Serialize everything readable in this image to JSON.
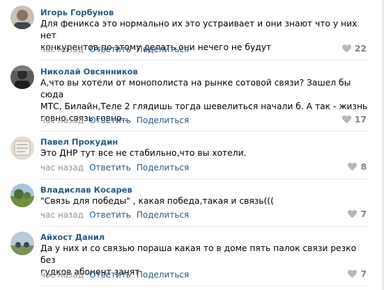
{
  "comments": [
    {
      "author": "Игорь Горбунов",
      "text": "Для феникса это нормально их это устраивает и они знают что у них нет\nконкурентов,по этому делать они нечего не будут",
      "time": "час назад",
      "reply": "Ответить",
      "share": "Поделиться",
      "likes": "22",
      "avatar_color": "#b7a99a"
    },
    {
      "author": "Николай Овсянников",
      "text": "А,что вы хотели от монополиста на рынке сотовой связи? Зашел бы сюда\nМТС, Билайн,Теле 2 глядишь тогда шевелиться начали б. А так - жизнь\nговно,связь говно...",
      "time": "час назад",
      "reply": "Ответить",
      "share": "Поделиться",
      "likes": "17",
      "avatar_color": "#4a4a4a"
    },
    {
      "author": "Павел Прокудин",
      "text": "Это ДНР тут все не стабильно,что вы хотели.",
      "time": "час назад",
      "reply": "Ответить",
      "share": "Поделиться",
      "likes": "8",
      "avatar_color": "#d8cfc2"
    },
    {
      "author": "Владислав Косарев",
      "text": "\"Связь для победы\" , какая победа,такая и связь(((",
      "time": "час назад",
      "reply": "Ответить",
      "share": "Поделиться",
      "likes": "7",
      "avatar_color": "#7f9a5e"
    },
    {
      "author": "Айхост Данил",
      "text": "Да у них и со связью пораша какая то в доме пять палок связи резко без\nгудков абонент занят",
      "time": "час назад",
      "reply": "Ответить",
      "share": "Поделиться",
      "likes": "7",
      "avatar_color": "#8fa5b5"
    }
  ]
}
